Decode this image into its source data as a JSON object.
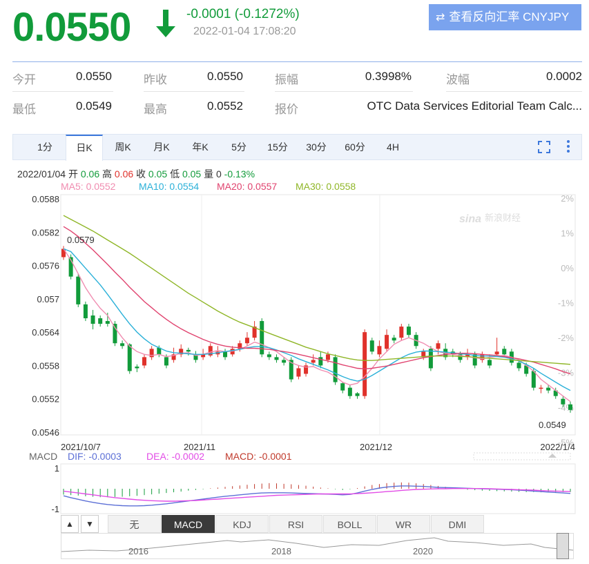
{
  "header": {
    "price": "0.0550",
    "change": "-0.0001 (-0.1272%)",
    "timestamp": "2022-01-04 17:08:20",
    "reverse_button": "查看反向汇率 CNYJPY",
    "down_color": "#119b3a"
  },
  "quote": {
    "open_label": "今开",
    "open": "0.0550",
    "prev_close_label": "昨收",
    "prev_close": "0.0550",
    "amplitude_label": "振幅",
    "amplitude": "0.3998%",
    "wave_label": "波幅",
    "wave": "0.0002",
    "low_label": "最低",
    "low": "0.0549",
    "high_label": "最高",
    "high": "0.0552",
    "source_label": "报价",
    "source": "OTC Data Services Editorial Team Calc..."
  },
  "tabs": [
    "1分",
    "日K",
    "周K",
    "月K",
    "年K",
    "5分",
    "15分",
    "30分",
    "60分",
    "4H"
  ],
  "active_tab": "日K",
  "info": {
    "date": "2022/01/04",
    "open_label": "开",
    "open": "0.06",
    "high_label": "高",
    "high": "0.06",
    "close_label": "收",
    "close": "0.05",
    "low_label": "低",
    "low": "0.05",
    "vol_label": "量",
    "vol": "0",
    "pct": "-0.13%",
    "ma5": "MA5: 0.0552",
    "ma10": "MA10: 0.0554",
    "ma20": "MA20: 0.0557",
    "ma30": "MA30: 0.0558"
  },
  "watermark": "新浪财经",
  "colors": {
    "up": "#e0312b",
    "down": "#119b3a",
    "ma5": "#f08cb0",
    "ma10": "#2ab0d8",
    "ma20": "#e0426e",
    "ma30": "#8fb627",
    "dif": "#5b6fd6",
    "dea": "#e24ce6",
    "macd": "#c0392b"
  },
  "macd_legend": {
    "title": "MACD",
    "dif": "DIF: -0.0003",
    "dea": "DEA: -0.0002",
    "macd": "MACD: -0.0001"
  },
  "indicator_tabs": [
    "无",
    "MACD",
    "KDJ",
    "RSI",
    "BOLL",
    "WR",
    "DMI"
  ],
  "active_indicator": "MACD",
  "navigator": {
    "years": [
      "2016",
      "2018",
      "2020"
    ]
  },
  "chart_data": {
    "type": "candlestick",
    "y_ticks": [
      "0.0588",
      "0.0582",
      "0.0576",
      "0.057",
      "0.0564",
      "0.0558",
      "0.0552",
      "0.0546"
    ],
    "ylim": [
      0.0546,
      0.0588
    ],
    "pct_ticks": [
      "2%",
      "1%",
      "0%",
      "-1%",
      "-2%",
      "-3%",
      "-4%",
      "-5%"
    ],
    "x_labels": [
      "2021/10/7",
      "2021/11",
      "2021/12",
      "2022/1/4"
    ],
    "max_label": "0.0579",
    "min_label": "0.0549",
    "candles": [
      {
        "o": 0.05775,
        "c": 0.0579,
        "h": 0.05795,
        "l": 0.0577
      },
      {
        "o": 0.05775,
        "c": 0.0574,
        "h": 0.0578,
        "l": 0.05735
      },
      {
        "o": 0.0574,
        "c": 0.0569,
        "h": 0.05745,
        "l": 0.05685
      },
      {
        "o": 0.0569,
        "c": 0.05665,
        "h": 0.05695,
        "l": 0.0566
      },
      {
        "o": 0.0567,
        "c": 0.05655,
        "h": 0.0568,
        "l": 0.05645
      },
      {
        "o": 0.05665,
        "c": 0.05655,
        "h": 0.0567,
        "l": 0.0565
      },
      {
        "o": 0.0566,
        "c": 0.05655,
        "h": 0.05675,
        "l": 0.0565
      },
      {
        "o": 0.05655,
        "c": 0.0562,
        "h": 0.0566,
        "l": 0.05615
      },
      {
        "o": 0.0562,
        "c": 0.05615,
        "h": 0.05625,
        "l": 0.0561
      },
      {
        "o": 0.05618,
        "c": 0.0557,
        "h": 0.0562,
        "l": 0.05565
      },
      {
        "o": 0.05578,
        "c": 0.05575,
        "h": 0.05582,
        "l": 0.05568
      },
      {
        "o": 0.0558,
        "c": 0.05595,
        "h": 0.056,
        "l": 0.05575
      },
      {
        "o": 0.05595,
        "c": 0.0561,
        "h": 0.05615,
        "l": 0.0559
      },
      {
        "o": 0.05612,
        "c": 0.056,
        "h": 0.05616,
        "l": 0.05595
      },
      {
        "o": 0.05595,
        "c": 0.0558,
        "h": 0.056,
        "l": 0.05575
      },
      {
        "o": 0.0559,
        "c": 0.056,
        "h": 0.05612,
        "l": 0.05585
      },
      {
        "o": 0.056,
        "c": 0.0561,
        "h": 0.05618,
        "l": 0.05595
      },
      {
        "o": 0.05608,
        "c": 0.05605,
        "h": 0.05612,
        "l": 0.05598
      },
      {
        "o": 0.056,
        "c": 0.0559,
        "h": 0.05606,
        "l": 0.05585
      },
      {
        "o": 0.05595,
        "c": 0.056,
        "h": 0.0561,
        "l": 0.0559
      },
      {
        "o": 0.05598,
        "c": 0.05615,
        "h": 0.0562,
        "l": 0.05595
      },
      {
        "o": 0.056,
        "c": 0.05605,
        "h": 0.05615,
        "l": 0.05595
      },
      {
        "o": 0.05605,
        "c": 0.05595,
        "h": 0.0561,
        "l": 0.0559
      },
      {
        "o": 0.056,
        "c": 0.0561,
        "h": 0.05615,
        "l": 0.05596
      },
      {
        "o": 0.0561,
        "c": 0.0562,
        "h": 0.05625,
        "l": 0.05605
      },
      {
        "o": 0.0562,
        "c": 0.0563,
        "h": 0.0564,
        "l": 0.05615
      },
      {
        "o": 0.0563,
        "c": 0.0565,
        "h": 0.0566,
        "l": 0.05625
      },
      {
        "o": 0.0566,
        "c": 0.056,
        "h": 0.05665,
        "l": 0.05595
      },
      {
        "o": 0.056,
        "c": 0.05595,
        "h": 0.05605,
        "l": 0.0559
      },
      {
        "o": 0.05595,
        "c": 0.0559,
        "h": 0.056,
        "l": 0.05585
      },
      {
        "o": 0.0559,
        "c": 0.05585,
        "h": 0.05595,
        "l": 0.0558
      },
      {
        "o": 0.0559,
        "c": 0.05555,
        "h": 0.05595,
        "l": 0.0555
      },
      {
        "o": 0.0556,
        "c": 0.05575,
        "h": 0.0558,
        "l": 0.05555
      },
      {
        "o": 0.05565,
        "c": 0.0558,
        "h": 0.05585,
        "l": 0.0556
      },
      {
        "o": 0.05585,
        "c": 0.0559,
        "h": 0.056,
        "l": 0.0558
      },
      {
        "o": 0.05595,
        "c": 0.0558,
        "h": 0.05605,
        "l": 0.05575
      },
      {
        "o": 0.0559,
        "c": 0.056,
        "h": 0.05605,
        "l": 0.05585
      },
      {
        "o": 0.05595,
        "c": 0.0555,
        "h": 0.056,
        "l": 0.05545
      },
      {
        "o": 0.05548,
        "c": 0.05535,
        "h": 0.0555,
        "l": 0.0553
      },
      {
        "o": 0.0554,
        "c": 0.05525,
        "h": 0.05545,
        "l": 0.0552
      },
      {
        "o": 0.0553,
        "c": 0.05525,
        "h": 0.05532,
        "l": 0.0552
      },
      {
        "o": 0.05525,
        "c": 0.0564,
        "h": 0.05645,
        "l": 0.0552
      },
      {
        "o": 0.05625,
        "c": 0.05605,
        "h": 0.0563,
        "l": 0.056
      },
      {
        "o": 0.056,
        "c": 0.05615,
        "h": 0.05625,
        "l": 0.05595
      },
      {
        "o": 0.0561,
        "c": 0.05635,
        "h": 0.05645,
        "l": 0.05605
      },
      {
        "o": 0.0563,
        "c": 0.05625,
        "h": 0.05635,
        "l": 0.0562
      },
      {
        "o": 0.0563,
        "c": 0.0565,
        "h": 0.05655,
        "l": 0.05625
      },
      {
        "o": 0.0565,
        "c": 0.05635,
        "h": 0.05655,
        "l": 0.0563
      },
      {
        "o": 0.05635,
        "c": 0.05615,
        "h": 0.0564,
        "l": 0.0561
      },
      {
        "o": 0.05595,
        "c": 0.05605,
        "h": 0.0561,
        "l": 0.0559
      },
      {
        "o": 0.0561,
        "c": 0.05575,
        "h": 0.05615,
        "l": 0.0557
      },
      {
        "o": 0.0561,
        "c": 0.0562,
        "h": 0.05625,
        "l": 0.056
      },
      {
        "o": 0.0561,
        "c": 0.05595,
        "h": 0.0562,
        "l": 0.0559
      },
      {
        "o": 0.05605,
        "c": 0.056,
        "h": 0.0561,
        "l": 0.05595
      },
      {
        "o": 0.056,
        "c": 0.0559,
        "h": 0.05605,
        "l": 0.05585
      },
      {
        "o": 0.05595,
        "c": 0.056,
        "h": 0.0561,
        "l": 0.0559
      },
      {
        "o": 0.056,
        "c": 0.0558,
        "h": 0.05605,
        "l": 0.05575
      },
      {
        "o": 0.0559,
        "c": 0.056,
        "h": 0.05605,
        "l": 0.05585
      },
      {
        "o": 0.0559,
        "c": 0.0558,
        "h": 0.056,
        "l": 0.05575
      },
      {
        "o": 0.056,
        "c": 0.05605,
        "h": 0.0563,
        "l": 0.05598
      },
      {
        "o": 0.0561,
        "c": 0.056,
        "h": 0.05615,
        "l": 0.05595
      },
      {
        "o": 0.05605,
        "c": 0.05585,
        "h": 0.0561,
        "l": 0.0558
      },
      {
        "o": 0.05585,
        "c": 0.05575,
        "h": 0.0559,
        "l": 0.0557
      },
      {
        "o": 0.0558,
        "c": 0.05565,
        "h": 0.05585,
        "l": 0.0556
      },
      {
        "o": 0.0557,
        "c": 0.0554,
        "h": 0.05575,
        "l": 0.05535
      },
      {
        "o": 0.05538,
        "c": 0.0554,
        "h": 0.05545,
        "l": 0.0553
      },
      {
        "o": 0.0554,
        "c": 0.05535,
        "h": 0.05545,
        "l": 0.0553
      },
      {
        "o": 0.05535,
        "c": 0.05525,
        "h": 0.0554,
        "l": 0.0552
      },
      {
        "o": 0.0552,
        "c": 0.0551,
        "h": 0.05525,
        "l": 0.05505
      },
      {
        "o": 0.0551,
        "c": 0.055,
        "h": 0.05515,
        "l": 0.05495
      }
    ],
    "ma5": [
      0.0579,
      0.0577,
      0.05745,
      0.0572,
      0.057,
      0.05683,
      0.0567,
      0.05648,
      0.0563,
      0.05615,
      0.05605,
      0.056,
      0.05598,
      0.056,
      0.05596,
      0.05598,
      0.05602,
      0.05603,
      0.05598,
      0.056,
      0.05604,
      0.05607,
      0.05605,
      0.05606,
      0.05609,
      0.05615,
      0.05622,
      0.05618,
      0.05612,
      0.05605,
      0.05595,
      0.05585,
      0.0558,
      0.05577,
      0.05578,
      0.05572,
      0.05568,
      0.0556,
      0.0555,
      0.05545,
      0.05548,
      0.0556,
      0.05575,
      0.05592,
      0.05605,
      0.05618,
      0.05625,
      0.0563,
      0.05625,
      0.0562,
      0.05612,
      0.05605,
      0.05602,
      0.056,
      0.05598,
      0.05596,
      0.05594,
      0.05592,
      0.05595,
      0.05596,
      0.05598,
      0.05595,
      0.0559,
      0.0558,
      0.0557,
      0.05555,
      0.05545,
      0.05535,
      0.05525,
      0.05515
    ],
    "ma10": [
      0.0579,
      0.05785,
      0.0577,
      0.05755,
      0.0574,
      0.05725,
      0.05708,
      0.0569,
      0.05672,
      0.05655,
      0.0564,
      0.05628,
      0.05618,
      0.05612,
      0.05606,
      0.05603,
      0.05602,
      0.05601,
      0.056,
      0.056,
      0.05601,
      0.05603,
      0.05605,
      0.05607,
      0.05609,
      0.05612,
      0.05614,
      0.05614,
      0.05612,
      0.05608,
      0.05603,
      0.05598,
      0.05592,
      0.05587,
      0.05582,
      0.05577,
      0.05572,
      0.05566,
      0.0556,
      0.05555,
      0.05552,
      0.05555,
      0.05562,
      0.0557,
      0.05578,
      0.05586,
      0.05594,
      0.056,
      0.05604,
      0.05606,
      0.05606,
      0.05605,
      0.05604,
      0.05603,
      0.05601,
      0.056,
      0.05598,
      0.05597,
      0.05597,
      0.05596,
      0.05595,
      0.05592,
      0.05588,
      0.05582,
      0.05575,
      0.05566,
      0.05558,
      0.0555,
      0.05542,
      0.05535
    ],
    "ma20": [
      0.0583,
      0.05822,
      0.05812,
      0.058,
      0.05788,
      0.05775,
      0.05762,
      0.05748,
      0.05735,
      0.05721,
      0.05708,
      0.05695,
      0.05684,
      0.05673,
      0.05663,
      0.05654,
      0.05646,
      0.05639,
      0.05633,
      0.05627,
      0.05622,
      0.05618,
      0.05615,
      0.05613,
      0.05612,
      0.05611,
      0.05611,
      0.0561,
      0.05609,
      0.05607,
      0.05605,
      0.05603,
      0.056,
      0.05597,
      0.05594,
      0.05591,
      0.05588,
      0.05585,
      0.05581,
      0.05578,
      0.05575,
      0.05574,
      0.05575,
      0.05577,
      0.05579,
      0.05582,
      0.05585,
      0.05588,
      0.05591,
      0.05594,
      0.05596,
      0.05598,
      0.056,
      0.05601,
      0.05602,
      0.05602,
      0.05601,
      0.056,
      0.05599,
      0.05598,
      0.05596,
      0.05594,
      0.05592,
      0.05589,
      0.05586,
      0.05582,
      0.05578,
      0.05574,
      0.05569,
      0.05565
    ],
    "ma30": [
      0.0585,
      0.05843,
      0.05836,
      0.05829,
      0.05822,
      0.05814,
      0.05806,
      0.05798,
      0.0579,
      0.05782,
      0.05773,
      0.05764,
      0.05755,
      0.05746,
      0.05737,
      0.05728,
      0.05719,
      0.0571,
      0.05702,
      0.05694,
      0.05686,
      0.05678,
      0.05671,
      0.05664,
      0.05658,
      0.05653,
      0.05648,
      0.05643,
      0.05638,
      0.05633,
      0.05628,
      0.05623,
      0.05618,
      0.05613,
      0.05609,
      0.05605,
      0.05601,
      0.05598,
      0.05595,
      0.05592,
      0.0559,
      0.05589,
      0.05589,
      0.0559,
      0.05591,
      0.05592,
      0.05593,
      0.05594,
      0.05595,
      0.05596,
      0.05597,
      0.05597,
      0.05597,
      0.05597,
      0.05596,
      0.05596,
      0.05595,
      0.05594,
      0.05593,
      0.05592,
      0.05591,
      0.0559,
      0.05589,
      0.05588,
      0.05587,
      0.05586,
      0.05585,
      0.05584,
      0.05583,
      0.05582
    ],
    "macd": {
      "ylim": [
        -1,
        1
      ],
      "y_ticks": [
        "1",
        "-1"
      ],
      "hist": [
        -0.25,
        -0.27,
        -0.29,
        -0.32,
        -0.34,
        -0.36,
        -0.36,
        -0.35,
        -0.34,
        -0.32,
        -0.3,
        -0.27,
        -0.24,
        -0.21,
        -0.18,
        -0.15,
        -0.12,
        -0.08,
        -0.05,
        -0.02,
        0.02,
        0.05,
        0.08,
        0.11,
        0.14,
        0.17,
        0.2,
        0.22,
        0.24,
        0.23,
        0.21,
        0.19,
        0.16,
        0.13,
        0.09,
        0.05,
        0.02,
        -0.02,
        -0.05,
        -0.02,
        0.03,
        0.1,
        0.16,
        0.2,
        0.24,
        0.26,
        0.27,
        0.26,
        0.23,
        0.2,
        0.16,
        0.12,
        0.08,
        0.04,
        0.0,
        -0.04,
        -0.06,
        -0.08,
        -0.09,
        -0.1,
        -0.11,
        -0.12,
        -0.13,
        -0.14,
        -0.14,
        -0.15,
        -0.15,
        -0.14,
        -0.14,
        -0.14
      ],
      "dif": [
        -0.3,
        -0.38,
        -0.45,
        -0.52,
        -0.58,
        -0.63,
        -0.67,
        -0.7,
        -0.72,
        -0.73,
        -0.73,
        -0.72,
        -0.7,
        -0.67,
        -0.64,
        -0.6,
        -0.56,
        -0.52,
        -0.48,
        -0.44,
        -0.4,
        -0.36,
        -0.32,
        -0.29,
        -0.26,
        -0.23,
        -0.2,
        -0.18,
        -0.17,
        -0.17,
        -0.17,
        -0.18,
        -0.19,
        -0.2,
        -0.21,
        -0.22,
        -0.23,
        -0.24,
        -0.26,
        -0.24,
        -0.18,
        -0.1,
        -0.03,
        0.03,
        0.07,
        0.1,
        0.12,
        0.12,
        0.11,
        0.1,
        0.08,
        0.06,
        0.05,
        0.04,
        0.03,
        0.02,
        0.01,
        0.0,
        -0.01,
        -0.02,
        -0.03,
        -0.04,
        -0.06,
        -0.08,
        -0.1,
        -0.12,
        -0.14,
        -0.16,
        -0.18,
        -0.2
      ],
      "dea": [
        -0.1,
        -0.14,
        -0.18,
        -0.22,
        -0.26,
        -0.3,
        -0.34,
        -0.38,
        -0.41,
        -0.44,
        -0.47,
        -0.49,
        -0.51,
        -0.52,
        -0.53,
        -0.53,
        -0.52,
        -0.51,
        -0.5,
        -0.48,
        -0.46,
        -0.44,
        -0.42,
        -0.4,
        -0.38,
        -0.36,
        -0.34,
        -0.32,
        -0.3,
        -0.28,
        -0.27,
        -0.26,
        -0.25,
        -0.24,
        -0.23,
        -0.22,
        -0.22,
        -0.22,
        -0.22,
        -0.22,
        -0.21,
        -0.19,
        -0.17,
        -0.15,
        -0.12,
        -0.1,
        -0.07,
        -0.05,
        -0.03,
        -0.02,
        -0.01,
        0.0,
        0.0,
        0.01,
        0.01,
        0.01,
        0.01,
        0.01,
        0.0,
        -0.01,
        -0.02,
        -0.03,
        -0.04,
        -0.05,
        -0.06,
        -0.08,
        -0.09,
        -0.1,
        -0.11,
        -0.12
      ]
    }
  }
}
